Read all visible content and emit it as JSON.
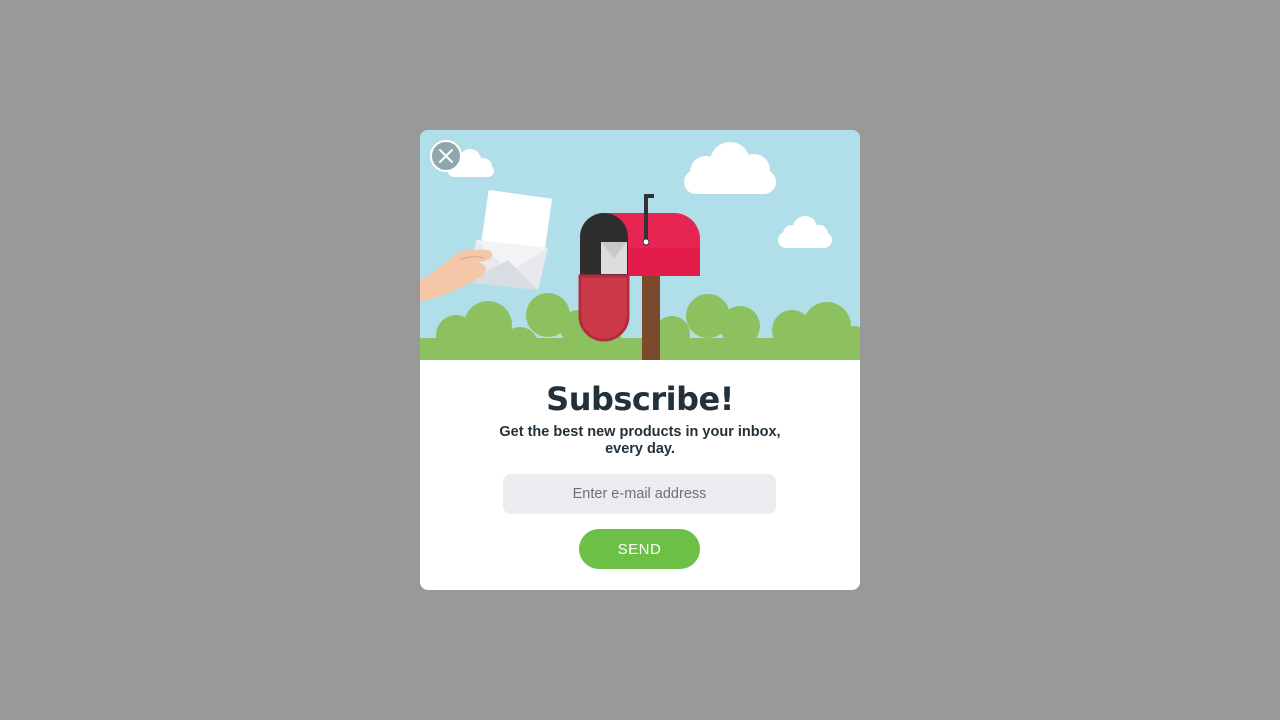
{
  "modal": {
    "title": "Subscribe!",
    "subtitle": "Get the best new products in your inbox, every day.",
    "email_placeholder": "Enter e-mail address",
    "send_label": "SEND"
  },
  "colors": {
    "backdrop": "#999999",
    "sky": "#b0dfe9",
    "bush": "#8dc160",
    "mailbox_red": "#e21b4a",
    "send_button": "#6cc046",
    "input_bg": "#ebebf0",
    "title_text": "#22313a"
  },
  "icons": {
    "close": "close-icon"
  }
}
